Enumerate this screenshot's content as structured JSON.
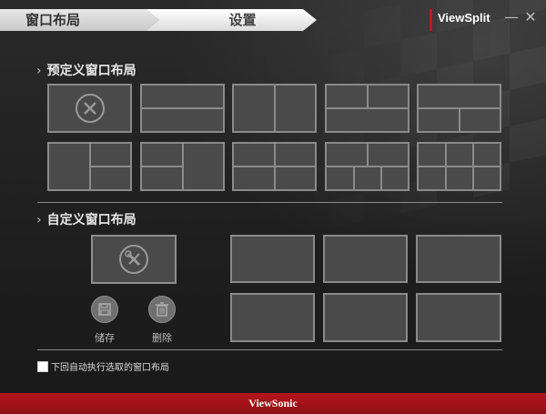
{
  "nav": {
    "tabs": [
      {
        "label": "窗口布局"
      },
      {
        "label": "设置"
      }
    ]
  },
  "brand": {
    "name": "ViewSplit",
    "accent": "#c0171c"
  },
  "window_controls": {
    "minimize": "—",
    "close": "✕"
  },
  "predefined": {
    "title": "预定义窗口布局",
    "layouts": [
      "none",
      "split-h",
      "split-v",
      "top-full-bottom-2",
      "top-2-bottom-full",
      "left-full-right-2",
      "left-2-right-full",
      "top-2-bottom-2",
      "top-2-bottom-3",
      "top-3-bottom-3"
    ]
  },
  "custom": {
    "title": "自定义窗口布局",
    "save_label": "储存",
    "delete_label": "删除",
    "slots": 6
  },
  "options": {
    "auto_apply_label": "下回自动执行选取的窗口布局"
  },
  "footer": {
    "brand": "ViewSonic"
  }
}
